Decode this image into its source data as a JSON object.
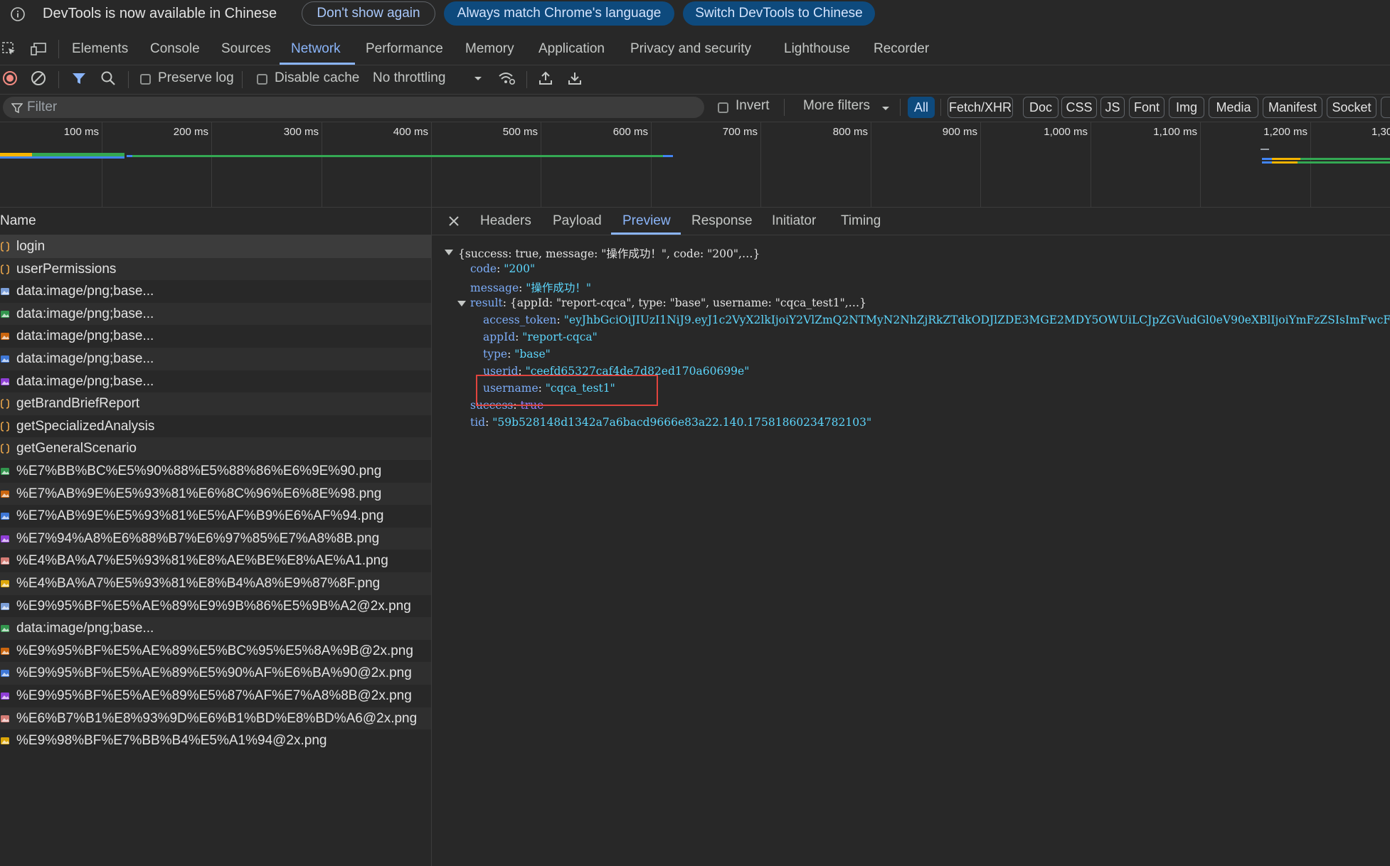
{
  "infobar": {
    "message": "DevTools is now available in Chinese",
    "btn_dont_show": "Don't show again",
    "btn_match_language": "Always match Chrome's language",
    "btn_switch": "Switch DevTools to Chinese"
  },
  "tabs": [
    "Elements",
    "Console",
    "Sources",
    "Network",
    "Performance",
    "Memory",
    "Application",
    "Privacy and security",
    "Lighthouse",
    "Recorder"
  ],
  "active_tab": "Network",
  "toolbar": {
    "preserve_log": "Preserve log",
    "disable_cache": "Disable cache",
    "throttling": "No throttling"
  },
  "filterbar": {
    "placeholder": "Filter",
    "invert": "Invert",
    "more_filters": "More filters",
    "chips": [
      "All",
      "Fetch/XHR",
      "Doc",
      "CSS",
      "JS",
      "Font",
      "Img",
      "Media",
      "Manifest",
      "Socket"
    ]
  },
  "timeline": {
    "ticks": [
      "100 ms",
      "200 ms",
      "300 ms",
      "400 ms",
      "500 ms",
      "600 ms",
      "700 ms",
      "800 ms",
      "900 ms",
      "1,000 ms",
      "1,100 ms",
      "1,200 ms",
      "1,30"
    ]
  },
  "request_list": {
    "header": "Name",
    "rows": [
      {
        "name": "login",
        "icon": "fetch-icon"
      },
      {
        "name": "userPermissions",
        "icon": "fetch-icon"
      },
      {
        "name": "data:image/png;base...",
        "icon": "image-icon"
      },
      {
        "name": "data:image/png;base...",
        "icon": "image-icon"
      },
      {
        "name": "data:image/png;base...",
        "icon": "image-icon"
      },
      {
        "name": "data:image/png;base...",
        "icon": "image-icon"
      },
      {
        "name": "data:image/png;base...",
        "icon": "image-icon"
      },
      {
        "name": "getBrandBriefReport",
        "icon": "fetch-icon"
      },
      {
        "name": "getSpecializedAnalysis",
        "icon": "fetch-icon"
      },
      {
        "name": "getGeneralScenario",
        "icon": "fetch-icon"
      },
      {
        "name": "%E7%BB%BC%E5%90%88%E5%88%86%E6%9E%90.png",
        "icon": "image-icon"
      },
      {
        "name": "%E7%AB%9E%E5%93%81%E6%8C%96%E6%8E%98.png",
        "icon": "image-icon"
      },
      {
        "name": "%E7%AB%9E%E5%93%81%E5%AF%B9%E6%AF%94.png",
        "icon": "image-icon"
      },
      {
        "name": "%E7%94%A8%E6%88%B7%E6%97%85%E7%A8%8B.png",
        "icon": "image-icon"
      },
      {
        "name": "%E4%BA%A7%E5%93%81%E8%AE%BE%E8%AE%A1.png",
        "icon": "image-icon"
      },
      {
        "name": "%E4%BA%A7%E5%93%81%E8%B4%A8%E9%87%8F.png",
        "icon": "image-icon"
      },
      {
        "name": "%E9%95%BF%E5%AE%89%E9%9B%86%E5%9B%A2@2x.png",
        "icon": "image-icon"
      },
      {
        "name": "data:image/png;base...",
        "icon": "image-icon"
      },
      {
        "name": "%E9%95%BF%E5%AE%89%E5%BC%95%E5%8A%9B@2x.png",
        "icon": "image-icon"
      },
      {
        "name": "%E9%95%BF%E5%AE%89%E5%90%AF%E6%BA%90@2x.png",
        "icon": "image-icon"
      },
      {
        "name": "%E9%95%BF%E5%AE%89%E5%87%AF%E7%A8%8B@2x.png",
        "icon": "image-icon"
      },
      {
        "name": "%E6%B7%B1%E8%93%9D%E6%B1%BD%E8%BD%A6@2x.png",
        "icon": "image-icon"
      },
      {
        "name": "%E9%98%BF%E7%BB%B4%E5%A1%94@2x.png",
        "icon": "image-icon"
      }
    ]
  },
  "details": {
    "tabs": [
      "Headers",
      "Payload",
      "Preview",
      "Response",
      "Initiator",
      "Timing"
    ],
    "active_tab": "Preview",
    "preview": {
      "root_summary": "{success: true, message: \"操作成功！\", code: \"200\",…}",
      "code_key": "code",
      "code_val": "\"200\"",
      "message_key": "message",
      "message_val": "\"操作成功！\"",
      "result_key": "result",
      "result_summary": "{appId: \"report-cqca\", type: \"base\", username: \"cqca_test1\",…}",
      "access_token_key": "access_token",
      "access_token_val": "\"eyJhbGciOiJIUzI1NiJ9.eyJ1c2VyX2lkIjoiY2VlZmQ2NTMyN2NhZjRkZTdkODJlZDE3MGE2MDY5OWUiLCJpZGVudGl0eV90eXBlIjoiYmFzZSIsImFwcF9pZCI6Im",
      "appid_key": "appId",
      "appid_val": "\"report-cqca\"",
      "type_key": "type",
      "type_val": "\"base\"",
      "userid_key": "userid",
      "userid_val": "\"ceefd65327caf4de7d82ed170a60699e\"",
      "username_key": "username",
      "username_val": "\"cqca_test1\"",
      "success_key": "success",
      "success_val": "true",
      "tid_key": "tid",
      "tid_val": "\"59b528148d1342a7a6bacd9666e83a22.140.17581860234782103\""
    }
  },
  "colors": {
    "accent": "#8ab4f8",
    "highlight_box": "#e0443e",
    "string_value": "#5cd5fb",
    "key": "#7cacf8"
  }
}
